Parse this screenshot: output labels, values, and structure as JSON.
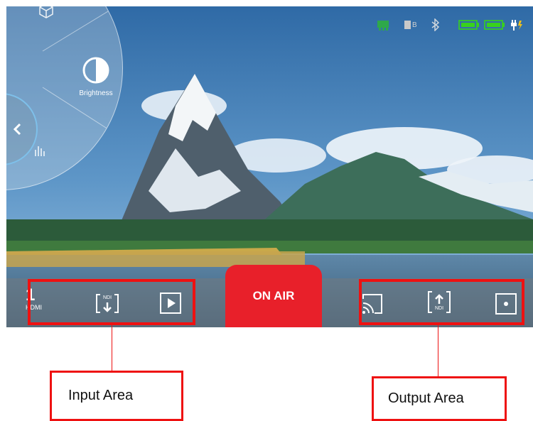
{
  "colors": {
    "accent": "#e8202a",
    "annotation": "#ee1111",
    "connected": "#2ea84a",
    "battery": "#38d21c"
  },
  "status_bar": {
    "icons": [
      "network-connected-icon",
      "sd-card-icon",
      "bluetooth-icon",
      "battery-1-icon",
      "battery-2-icon",
      "power-plug-icon"
    ],
    "sd_label": "B"
  },
  "wheel": {
    "items": [
      {
        "name": "3d-lut-icon"
      },
      {
        "name": "brightness-icon",
        "label": "Brightness"
      },
      {
        "name": "histogram-icon"
      }
    ],
    "back_icon": "chevron-left-icon"
  },
  "input_area": {
    "hdmi_number": "1",
    "hdmi_label": "HDMI",
    "ndi_in_label": "NDI",
    "play_icon": "play-icon"
  },
  "on_air_label": "ON AIR",
  "output_area": {
    "cast_icon": "cast-icon",
    "ndi_out_label": "NDI",
    "record_icon": "record-icon"
  },
  "annotations": {
    "input_label": "Input Area",
    "output_label": "Output Area"
  }
}
